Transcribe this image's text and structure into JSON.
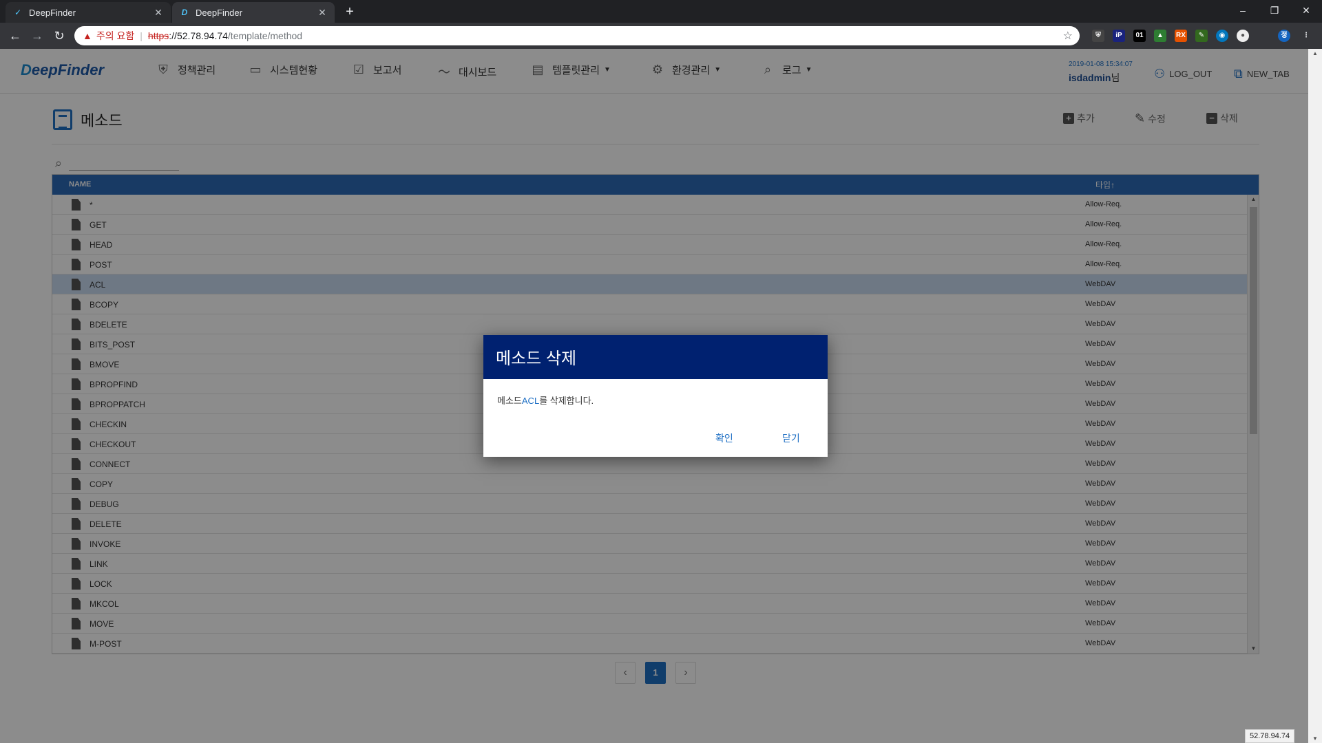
{
  "browser": {
    "tabs": [
      {
        "label": "DeepFinder"
      },
      {
        "label": "DeepFinder"
      }
    ],
    "url": {
      "warning_label": "주의 요함",
      "protocol": "https",
      "host": "://52.78.94.74",
      "path": "/template/method"
    },
    "status_url": "52.78.94.74"
  },
  "app": {
    "logo_prefix": "D",
    "logo_rest": "eepFinder",
    "menu": [
      {
        "label": "정책관리",
        "icon": "shield-icon"
      },
      {
        "label": "시스템현황",
        "icon": "monitor-icon"
      },
      {
        "label": "보고서",
        "icon": "clipboard-check-icon"
      },
      {
        "label": "대시보드",
        "icon": "trend-icon"
      },
      {
        "label": "템플릿관리",
        "icon": "template-icon",
        "dropdown": true
      },
      {
        "label": "환경관리",
        "icon": "gear-icon",
        "dropdown": true
      },
      {
        "label": "로그",
        "icon": "search-icon",
        "dropdown": true
      }
    ],
    "timestamp": "2019-01-08 15:34:07",
    "username": "isdadmin",
    "user_suffix": "님",
    "logout_label": "LOG_OUT",
    "newtab_label": "NEW_TAB"
  },
  "page": {
    "title": "메소드",
    "actions": {
      "add": "추가",
      "edit": "수정",
      "delete": "삭제"
    },
    "search": {
      "value": "",
      "placeholder": ""
    },
    "columns": {
      "name": "NAME",
      "type": "타입",
      "sort": "↑"
    },
    "rows": [
      {
        "name": "*",
        "type": "Allow-Req."
      },
      {
        "name": "GET",
        "type": "Allow-Req."
      },
      {
        "name": "HEAD",
        "type": "Allow-Req."
      },
      {
        "name": "POST",
        "type": "Allow-Req."
      },
      {
        "name": "ACL",
        "type": "WebDAV",
        "selected": true
      },
      {
        "name": "BCOPY",
        "type": "WebDAV"
      },
      {
        "name": "BDELETE",
        "type": "WebDAV"
      },
      {
        "name": "BITS_POST",
        "type": "WebDAV"
      },
      {
        "name": "BMOVE",
        "type": "WebDAV"
      },
      {
        "name": "BPROPFIND",
        "type": "WebDAV"
      },
      {
        "name": "BPROPPATCH",
        "type": "WebDAV"
      },
      {
        "name": "CHECKIN",
        "type": "WebDAV"
      },
      {
        "name": "CHECKOUT",
        "type": "WebDAV"
      },
      {
        "name": "CONNECT",
        "type": "WebDAV"
      },
      {
        "name": "COPY",
        "type": "WebDAV"
      },
      {
        "name": "DEBUG",
        "type": "WebDAV"
      },
      {
        "name": "DELETE",
        "type": "WebDAV"
      },
      {
        "name": "INVOKE",
        "type": "WebDAV"
      },
      {
        "name": "LINK",
        "type": "WebDAV"
      },
      {
        "name": "LOCK",
        "type": "WebDAV"
      },
      {
        "name": "MKCOL",
        "type": "WebDAV"
      },
      {
        "name": "MOVE",
        "type": "WebDAV"
      },
      {
        "name": "M-POST",
        "type": "WebDAV"
      }
    ],
    "pagination": {
      "current": "1"
    }
  },
  "dialog": {
    "title": "메소드 삭제",
    "message_prefix": "메소드",
    "message_highlight": "ACL",
    "message_suffix": "를 삭제합니다.",
    "confirm_label": "확인",
    "close_label": "닫기"
  },
  "colors": {
    "header_blue": "#2d6ab6",
    "dialog_navy": "#002170",
    "accent": "#1e6fc4"
  }
}
